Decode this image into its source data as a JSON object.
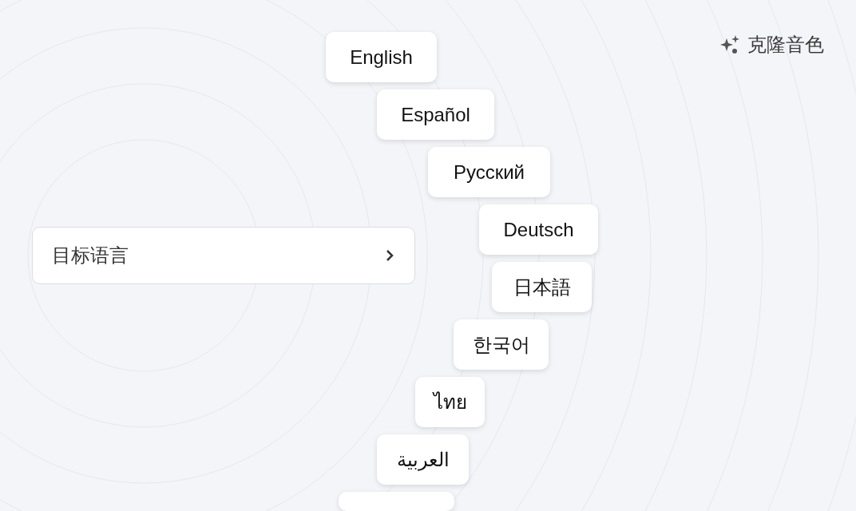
{
  "clone_button": {
    "label": "克隆音色"
  },
  "target_language": {
    "label": "目标语言"
  },
  "languages": [
    {
      "label": "English"
    },
    {
      "label": "Español"
    },
    {
      "label": "Русский"
    },
    {
      "label": "Deutsch"
    },
    {
      "label": "日本語"
    },
    {
      "label": "한국어"
    },
    {
      "label": "ไทย"
    },
    {
      "label": "العربية"
    },
    {
      "kind": "cut_off"
    }
  ]
}
